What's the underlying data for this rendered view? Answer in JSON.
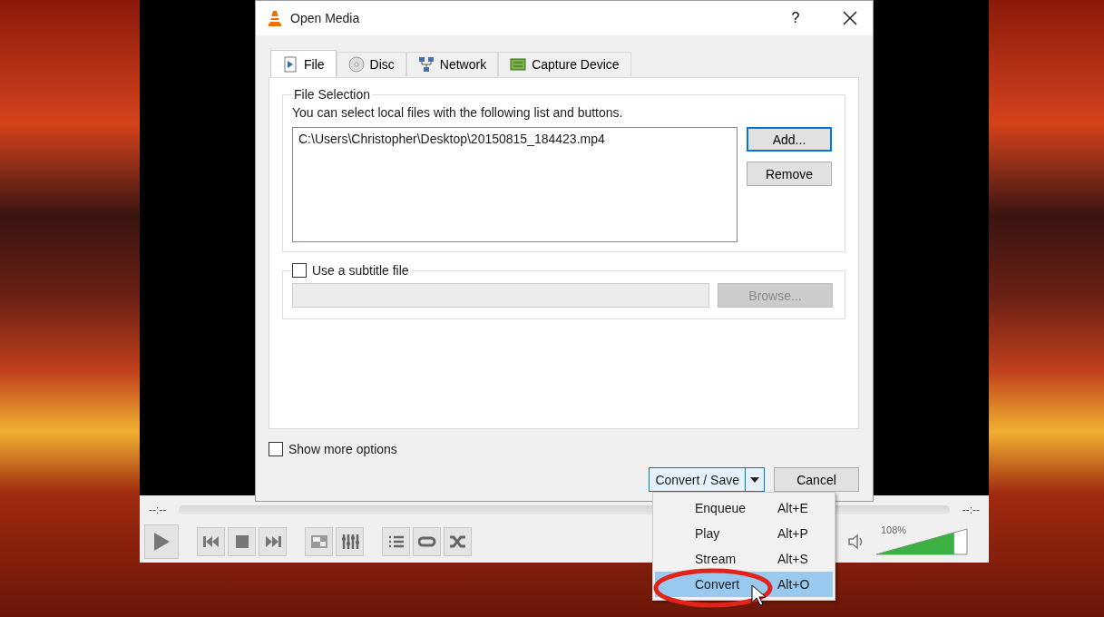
{
  "dialog": {
    "title": "Open Media",
    "help": "?",
    "tabs": [
      {
        "label": "File",
        "kind": "file",
        "selected": true
      },
      {
        "label": "Disc",
        "kind": "disc",
        "selected": false
      },
      {
        "label": "Network",
        "kind": "network",
        "selected": false
      },
      {
        "label": "Capture Device",
        "kind": "capture",
        "selected": false
      }
    ],
    "file_selection": {
      "legend": "File Selection",
      "hint": "You can select local files with the following list and buttons.",
      "files": [
        "C:\\Users\\Christopher\\Desktop\\20150815_184423.mp4"
      ],
      "add_button": "Add...",
      "remove_button": "Remove"
    },
    "subtitle": {
      "label": "Use a subtitle file",
      "checked": false,
      "browse_button": "Browse...",
      "disabled": true
    },
    "show_more": {
      "label": "Show more options",
      "checked": false
    },
    "primary_button": "Convert / Save",
    "cancel_button": "Cancel"
  },
  "menu": {
    "items": [
      {
        "label": "Enqueue",
        "shortcut": "Alt+E",
        "selected": false
      },
      {
        "label": "Play",
        "shortcut": "Alt+P",
        "selected": false
      },
      {
        "label": "Stream",
        "shortcut": "Alt+S",
        "selected": false
      },
      {
        "label": "Convert",
        "shortcut": "Alt+O",
        "selected": true
      }
    ]
  },
  "player": {
    "seek": {
      "level": 0
    },
    "time_elapsed": "--:--",
    "time_total": "--:--",
    "volume": {
      "reading": "108%",
      "level": 0.86
    }
  }
}
